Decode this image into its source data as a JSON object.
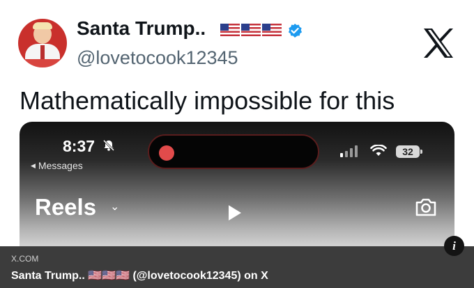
{
  "tweet": {
    "author_name": "Santa Trump..",
    "author_flags": "🇺🇸🇺🇸🇺🇸",
    "handle": "@lovetocook12345",
    "text": "Mathematically impossible for this",
    "verified": true,
    "verified_color": "#1d9bf0",
    "platform_icon": "x-logo-icon"
  },
  "media": {
    "status_time": "8:37",
    "back_label": "Messages",
    "battery": "32",
    "screen_title": "Reels",
    "recording_color": "#e14b4b",
    "icons": [
      "bell-slash-icon",
      "signal-icon",
      "wifi-icon",
      "battery-icon",
      "chevron-down-icon",
      "play-icon",
      "camera-icon"
    ]
  },
  "footer": {
    "domain": "X.COM",
    "title": "Santa Trump.. 🇺🇸🇺🇸🇺🇸 (@lovetocook12345) on X",
    "background": "#3c3c3c"
  },
  "info_button": "i"
}
